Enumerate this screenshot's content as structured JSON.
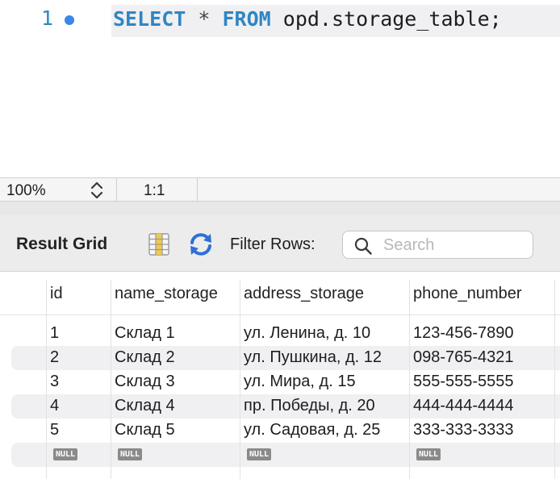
{
  "editor": {
    "line_number": "1",
    "query": {
      "kw_select": "SELECT",
      "star": "*",
      "kw_from": "FROM",
      "table": "opd.storage_table;"
    }
  },
  "status": {
    "zoom": "100%",
    "cursor_position": "1:1"
  },
  "toolbar": {
    "result_grid_label": "Result Grid",
    "filter_label": "Filter Rows:",
    "search_placeholder": "Search",
    "search_value": ""
  },
  "grid": {
    "columns": [
      "id",
      "name_storage",
      "address_storage",
      "phone_number"
    ],
    "rows": [
      [
        "1",
        "Склад 1",
        "ул. Ленина, д. 10",
        "123-456-7890"
      ],
      [
        "2",
        "Склад 2",
        "ул. Пушкина, д. 12",
        "098-765-4321"
      ],
      [
        "3",
        "Склад 3",
        "ул. Мира, д. 15",
        "555-555-5555"
      ],
      [
        "4",
        "Склад 4",
        "пр. Победы, д. 20",
        "444-444-4444"
      ],
      [
        "5",
        "Склад 5",
        "ул. Садовая, д. 25",
        "333-333-3333"
      ]
    ],
    "null_row": [
      "NULL",
      "NULL",
      "NULL",
      "NULL"
    ]
  },
  "icons": {
    "breakpoint": "breakpoint-dot-icon",
    "zoom": "chevron-updown-icon",
    "grid": "grid-icon",
    "refresh": "refresh-icon",
    "search": "search-icon"
  },
  "colors": {
    "keyword": "#2f86c3",
    "breakpoint": "#3b86e6",
    "null_badge": "#8a8a8a"
  }
}
